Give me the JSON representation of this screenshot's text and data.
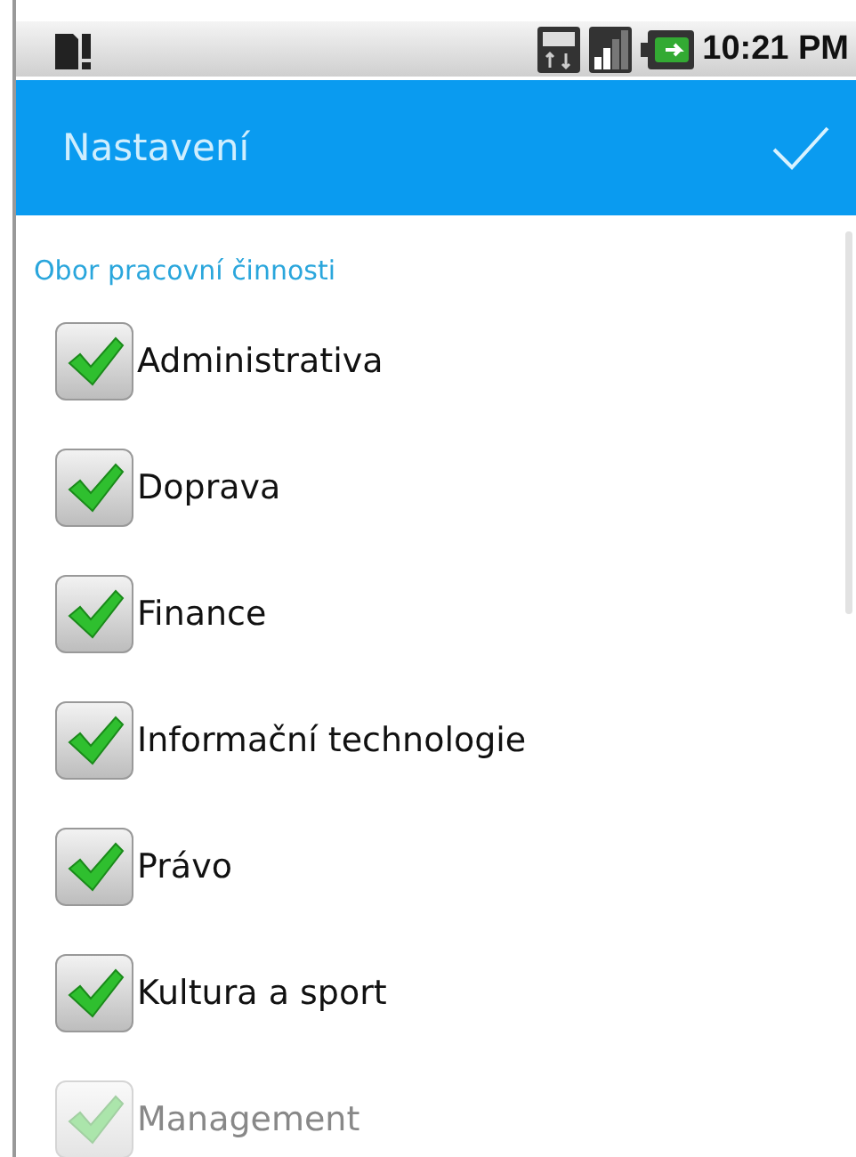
{
  "status_bar": {
    "time": "10:21 PM"
  },
  "action_bar": {
    "title": "Nastavení"
  },
  "section": {
    "title": "Obor pracovní činnosti"
  },
  "options": [
    {
      "label": "Administrativa",
      "checked": true,
      "disabled": false
    },
    {
      "label": "Doprava",
      "checked": true,
      "disabled": false
    },
    {
      "label": "Finance",
      "checked": true,
      "disabled": false
    },
    {
      "label": "Informační technologie",
      "checked": true,
      "disabled": false
    },
    {
      "label": "Právo",
      "checked": true,
      "disabled": false
    },
    {
      "label": "Kultura a sport",
      "checked": true,
      "disabled": false
    },
    {
      "label": "Management",
      "checked": true,
      "disabled": true
    }
  ]
}
